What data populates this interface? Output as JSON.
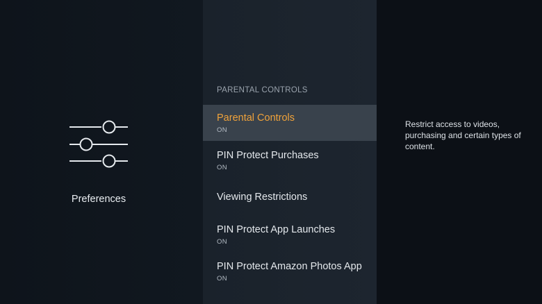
{
  "left": {
    "icon": "sliders-icon",
    "label": "Preferences"
  },
  "menu": {
    "header": "PARENTAL CONTROLS",
    "items": [
      {
        "title": "Parental Controls",
        "status": "ON",
        "selected": true
      },
      {
        "title": "PIN Protect Purchases",
        "status": "ON",
        "selected": false
      },
      {
        "title": "Viewing Restrictions",
        "status": "",
        "selected": false
      },
      {
        "title": "PIN Protect App Launches",
        "status": "ON",
        "selected": false
      },
      {
        "title": "PIN Protect Amazon Photos App",
        "status": "ON",
        "selected": false
      }
    ]
  },
  "description": "Restrict access to videos, purchasing and certain types of content.",
  "colors": {
    "accent": "#f0a23a",
    "selected_bg": "#39424c",
    "background": "#0f141b"
  }
}
